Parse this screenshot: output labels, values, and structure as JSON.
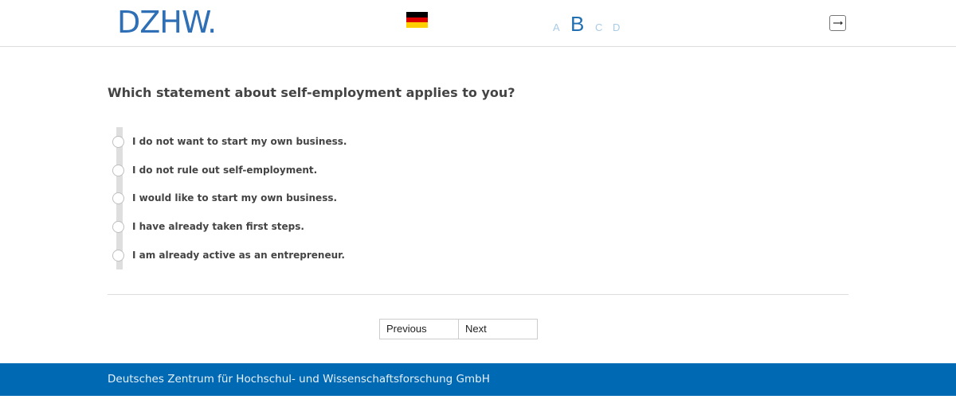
{
  "header": {
    "logo_text": "DZHW",
    "logo_dot": ".",
    "flag_colors": [
      "#000000",
      "#dd0000",
      "#ffce00"
    ],
    "stages": [
      {
        "label": "A",
        "active": false
      },
      {
        "label": "B",
        "active": true
      },
      {
        "label": "C",
        "active": false
      },
      {
        "label": "D",
        "active": false
      }
    ],
    "logout_icon": "logout-icon"
  },
  "main": {
    "question": "Which statement about self-employment applies to you?",
    "options": [
      "I do not want to start my own business.",
      "I do not rule out self-employment.",
      "I would like to start my own business.",
      "I have already taken first steps.",
      "I am already active as an entrepreneur."
    ]
  },
  "navigation": {
    "previous_label": "Previous",
    "next_label": "Next"
  },
  "footer": {
    "text": "Deutsches Zentrum für Hochschul- und Wissenschaftsforschung GmbH"
  },
  "colors": {
    "brand": "#0069b4",
    "stage_active": "#1f6fb2",
    "stage_inactive": "#a9cbe6"
  }
}
